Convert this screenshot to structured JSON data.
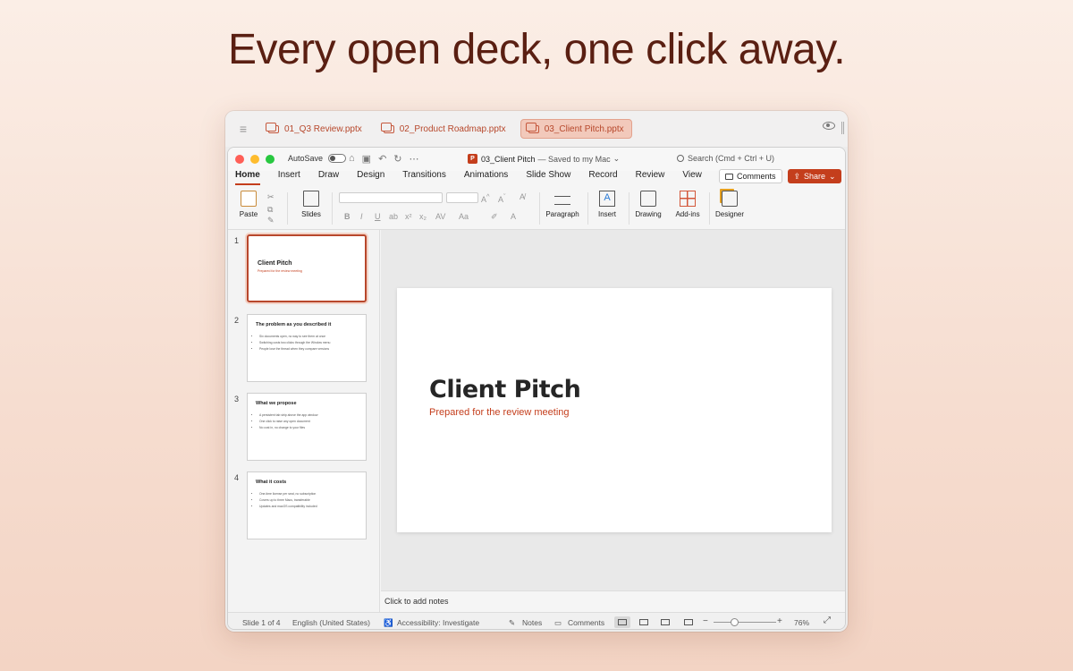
{
  "headline": "Every open deck, one click away.",
  "tabbar": {
    "tabs": [
      {
        "label": "01_Q3 Review.pptx",
        "active": false
      },
      {
        "label": "02_Product Roadmap.pptx",
        "active": false
      },
      {
        "label": "03_Client Pitch.pptx",
        "active": true
      }
    ]
  },
  "window": {
    "autosave_label": "AutoSave",
    "doc_name": "03_Client Pitch",
    "doc_status": "— Saved to my Mac",
    "search_placeholder": "Search (Cmd + Ctrl + U)",
    "comments_label": "Comments",
    "share_label": "Share"
  },
  "ribbon_tabs": [
    "Home",
    "Insert",
    "Draw",
    "Design",
    "Transitions",
    "Animations",
    "Slide Show",
    "Record",
    "Review",
    "View"
  ],
  "ribbon_groups": {
    "paste": "Paste",
    "slides": "Slides",
    "paragraph": "Paragraph",
    "insert": "Insert",
    "drawing": "Drawing",
    "addins": "Add-ins",
    "designer": "Designer"
  },
  "slides": [
    {
      "num": "1",
      "title": "Client Pitch",
      "subtitle": "Prepared for the review meeting",
      "bullets": []
    },
    {
      "num": "2",
      "title": "The problem as you described it",
      "bullets": [
        "Six documents open, no way to see them at once",
        "Switching costs two clicks through the Window menu",
        "People lose the thread when they compare versions"
      ]
    },
    {
      "num": "3",
      "title": "What we propose",
      "bullets": [
        "A persistent tab strip above the app window",
        "One click to raise any open document",
        "No cost in, no change to your files"
      ]
    },
    {
      "num": "4",
      "title": "What it costs",
      "bullets": [
        "One-time license per seat, no subscription",
        "Covers up to three Macs, transferable",
        "Updates and macOS compatibility included"
      ]
    }
  ],
  "main_slide": {
    "title": "Client Pitch",
    "subtitle": "Prepared for the review meeting"
  },
  "notes_placeholder": "Click to add notes",
  "status": {
    "slide_count": "Slide 1 of 4",
    "language": "English (United States)",
    "accessibility": "Accessibility: Investigate",
    "notes": "Notes",
    "comments": "Comments",
    "zoom_minus": "−",
    "zoom_plus": "+",
    "zoom": "76%"
  },
  "colors": {
    "accent": "#c43e1c",
    "headline": "#5a1f12",
    "tab_active_bg": "#f2c9bb"
  }
}
